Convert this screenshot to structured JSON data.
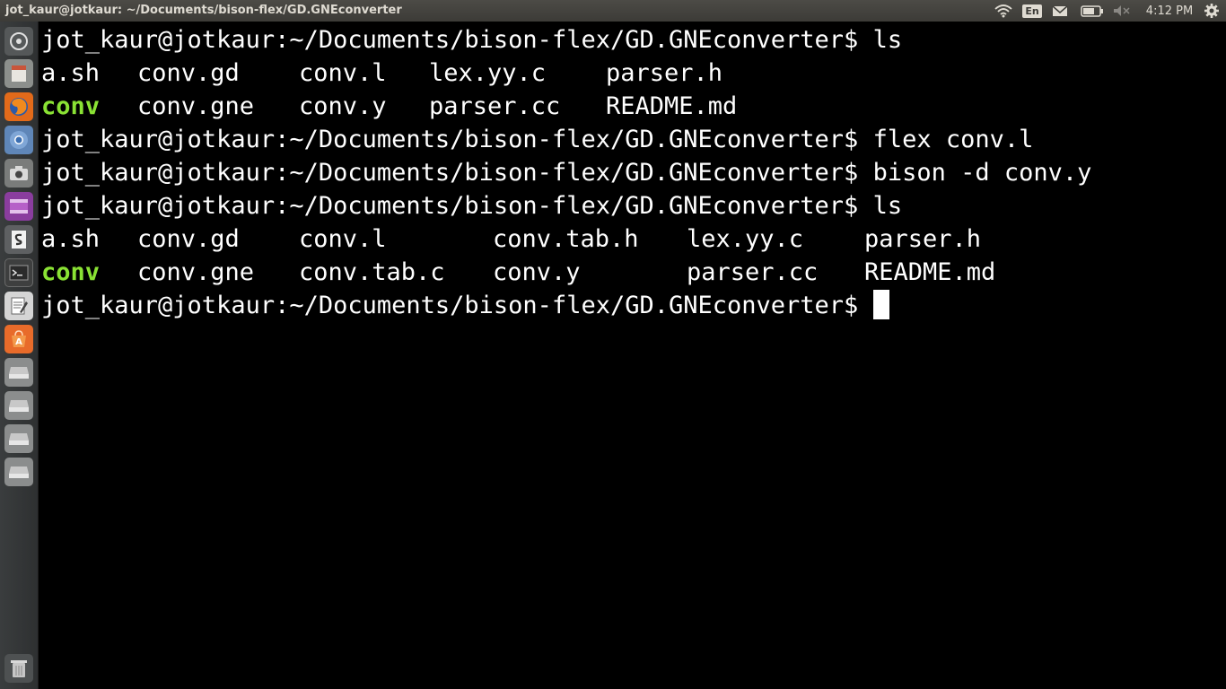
{
  "topbar": {
    "title": "jot_kaur@jotkaur: ~/Documents/bison-flex/GD.GNEconverter",
    "lang": "En",
    "clock": "4:12 PM",
    "icons": [
      "wifi-icon",
      "keyboard-layout-icon",
      "mail-icon",
      "battery-icon",
      "volume-muted-icon",
      "gear-icon"
    ]
  },
  "launcher": {
    "items": [
      "dash-icon",
      "files-icon",
      "firefox-icon",
      "chromium-icon",
      "camera-icon",
      "video-icon",
      "libreoffice-impress-icon",
      "terminal-icon",
      "text-editor-icon",
      "software-center-icon",
      "drive-icon",
      "drive-icon",
      "drive-icon",
      "drive-icon",
      "trash-icon"
    ]
  },
  "terminal": {
    "prompt": "jot_kaur@jotkaur:~/Documents/bison-flex/GD.GNEconverter$ ",
    "cmd1": "ls",
    "ls1": {
      "row1": [
        "a.sh",
        "conv.gd",
        "conv.l",
        "lex.yy.c",
        "parser.h"
      ],
      "row2": [
        "conv",
        "conv.gne",
        "conv.y",
        "parser.cc",
        "README.md"
      ]
    },
    "cmd2": "flex conv.l",
    "cmd3": "bison -d conv.y",
    "cmd4": "ls",
    "ls2": {
      "row1": [
        "a.sh",
        "conv.gd",
        "conv.l",
        "conv.tab.h",
        "lex.yy.c",
        "parser.h"
      ],
      "row2": [
        "conv",
        "conv.gne",
        "conv.tab.c",
        "conv.y",
        "parser.cc",
        "README.md"
      ]
    },
    "executable_color": "#8ae234"
  }
}
